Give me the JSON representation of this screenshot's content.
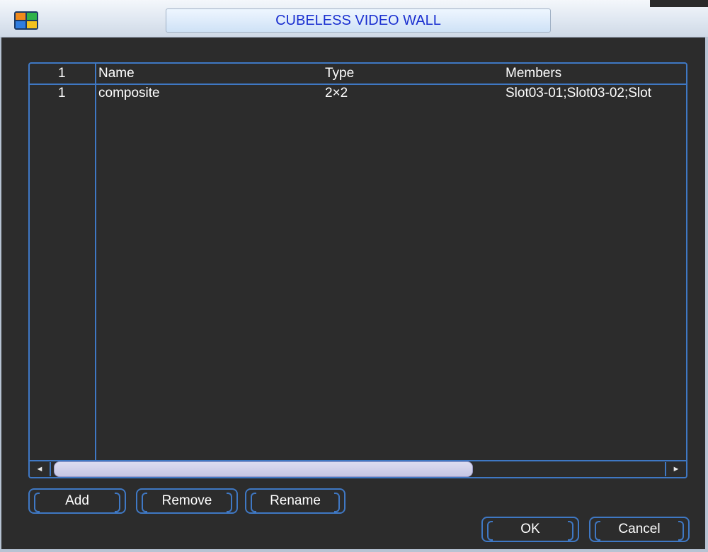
{
  "window": {
    "title": "CUBELESS VIDEO WALL",
    "icon": "video-wall-grid-icon"
  },
  "table": {
    "headers": {
      "index": "1",
      "name": "Name",
      "type": "Type",
      "members": "Members"
    },
    "rows": [
      {
        "index": "1",
        "name": "composite",
        "type": "2×2",
        "members": "Slot03-01;Slot03-02;Slot"
      }
    ]
  },
  "scrollbar": {
    "left_arrow": "◄",
    "right_arrow": "►"
  },
  "buttons": {
    "add": "Add",
    "remove": "Remove",
    "rename": "Rename",
    "ok": "OK",
    "cancel": "Cancel"
  },
  "colors": {
    "title_text": "#1a2fd0",
    "accent_border": "#3f78c4",
    "background": "#2c2c2c"
  }
}
